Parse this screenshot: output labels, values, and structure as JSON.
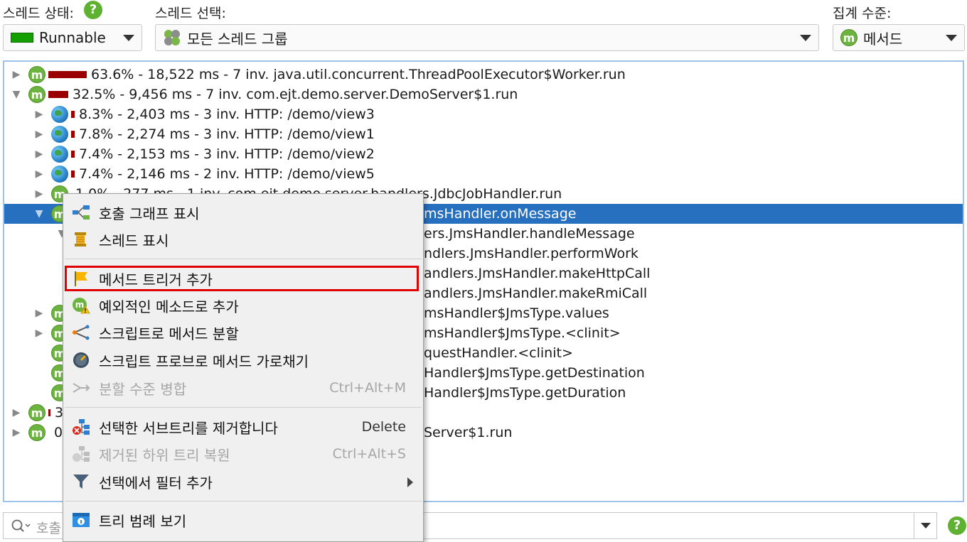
{
  "toolbar": {
    "thread_state_label": "스레드 상태:",
    "thread_state_value": "Runnable",
    "thread_state_color": "#13a000",
    "thread_select_label": "스레드 선택:",
    "thread_select_value": "모든 스레드 그룹",
    "aggregation_label": "집계 수준:",
    "aggregation_value": "메서드"
  },
  "tree": {
    "rows": [
      {
        "text": "63.6% - 18,522 ms - 7 inv. java.util.concurrent.ThreadPoolExecutor$Worker.run",
        "icon": "method-icon",
        "toggle": "collapsed",
        "bar_fraction": 0.636
      },
      {
        "text": "32.5% - 9,456 ms - 7 inv. com.ejt.demo.server.DemoServer$1.run",
        "icon": "method-icon",
        "toggle": "expanded",
        "bar_fraction": 0.325
      },
      {
        "text": "8.3% - 2,403 ms - 3 inv. HTTP: /demo/view3",
        "icon": "globe-icon",
        "toggle": "collapsed",
        "bar_fraction": 0.083
      },
      {
        "text": "7.8% - 2,274 ms - 3 inv. HTTP: /demo/view1",
        "icon": "globe-icon",
        "toggle": "collapsed",
        "bar_fraction": 0.078
      },
      {
        "text": "7.4% - 2,153 ms - 3 inv. HTTP: /demo/view2",
        "icon": "globe-icon",
        "toggle": "collapsed",
        "bar_fraction": 0.074
      },
      {
        "text": "7.4% - 2,146 ms - 2 inv. HTTP: /demo/view5",
        "icon": "globe-icon",
        "toggle": "collapsed",
        "bar_fraction": 0.074
      },
      {
        "text": "1.0% - 277 ms - 1 inv. com.ejt.demo.server.handlers.JdbcJobHandler.run",
        "icon": "method-icon",
        "toggle": "collapsed",
        "bar_fraction": 0
      },
      {
        "text": "msHandler.onMessage",
        "icon": "method-icon",
        "toggle": "expanded",
        "selected": true
      },
      {
        "text": "ers.JmsHandler.handleMessage",
        "icon": "method-icon",
        "toggle": "expanded"
      },
      {
        "text": "ndlers.JmsHandler.performWork",
        "icon": "method-icon",
        "toggle": ""
      },
      {
        "text": "andlers.JmsHandler.makeHttpCall",
        "icon": "method-icon",
        "toggle": ""
      },
      {
        "text": "andlers.JmsHandler.makeRmiCall",
        "icon": "method-icon",
        "toggle": ""
      },
      {
        "text": "msHandler$JmsType.values",
        "icon": "method-icon",
        "toggle": "collapsed"
      },
      {
        "text": "msHandler$JmsType.<clinit>",
        "icon": "method-icon",
        "toggle": "collapsed"
      },
      {
        "text": "questHandler.<clinit>",
        "icon": "method-icon",
        "toggle": ""
      },
      {
        "text": "Handler$JmsType.getDestination",
        "icon": "method-icon",
        "toggle": ""
      },
      {
        "text": "Handler$JmsType.getDuration",
        "icon": "method-icon",
        "toggle": ""
      },
      {
        "text": "3",
        "icon": "method-icon",
        "toggle": "collapsed",
        "bar_fraction": 0.003
      },
      {
        "text": "0",
        "icon": "method-icon",
        "toggle": "collapsed",
        "right_text": "Server$1.run"
      }
    ]
  },
  "context_menu": {
    "items": [
      {
        "label": "호출 그래프 표시",
        "icon": "call-graph-icon"
      },
      {
        "label": "스레드 표시",
        "icon": "thread-icon"
      },
      {
        "label": "메서드 트리거 추가",
        "icon": "flag-icon",
        "highlighted": true
      },
      {
        "label": "예외적인 메소드로 추가",
        "icon": "exceptional-method-icon"
      },
      {
        "label": "스크립트로 메서드 분할",
        "icon": "split-icon"
      },
      {
        "label": "스크립트 프로브로 메서드 가로채기",
        "icon": "probe-icon"
      },
      {
        "label": "분할 수준 병합",
        "icon": "merge-icon",
        "disabled": true,
        "shortcut": "Ctrl+Alt+M"
      },
      {
        "label": "선택한 서브트리를 제거합니다",
        "icon": "remove-subtree-icon",
        "shortcut": "Delete"
      },
      {
        "label": "제거된 하위 트리 복원",
        "icon": "restore-subtree-icon",
        "disabled": true,
        "shortcut": "Ctrl+Alt+S"
      },
      {
        "label": "선택에서 필터 추가",
        "icon": "filter-icon",
        "submenu": true
      },
      {
        "label": "트리 범례 보기",
        "icon": "legend-icon"
      }
    ]
  },
  "search": {
    "placeholder": "호출"
  }
}
